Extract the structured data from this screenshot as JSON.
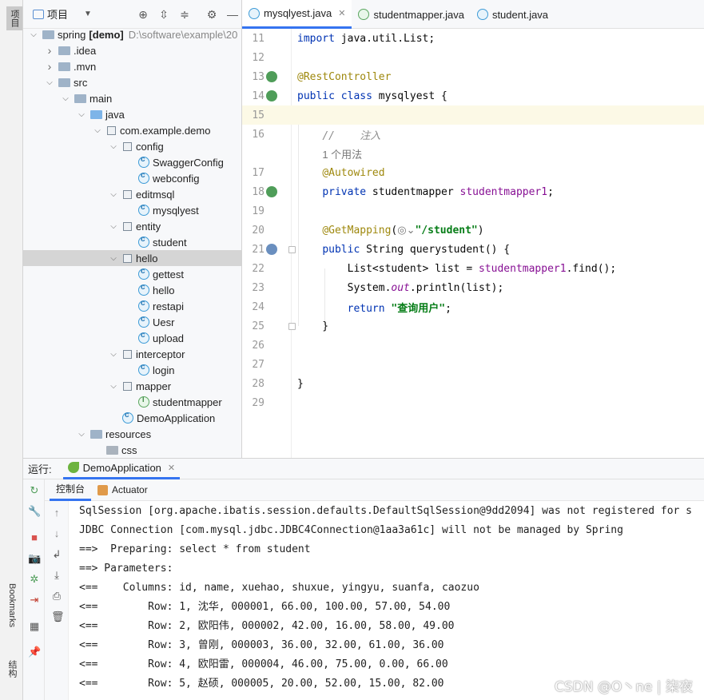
{
  "left_strip": {
    "project_tab": "项目",
    "bookmarks_tab": "Bookmarks",
    "structure_tab": "结构"
  },
  "project": {
    "header_title": "项目",
    "tree": [
      {
        "label": "spring",
        "bold_suffix": "[demo]",
        "path": "D:\\software\\example\\20",
        "depth": 0,
        "kind": "folder",
        "open": true
      },
      {
        "label": ".idea",
        "depth": 1,
        "kind": "folder",
        "open": false
      },
      {
        "label": ".mvn",
        "depth": 1,
        "kind": "folder",
        "open": false
      },
      {
        "label": "src",
        "depth": 1,
        "kind": "folder",
        "open": true
      },
      {
        "label": "main",
        "depth": 2,
        "kind": "folder",
        "open": true
      },
      {
        "label": "java",
        "depth": 3,
        "kind": "folder-blue",
        "open": true
      },
      {
        "label": "com.example.demo",
        "depth": 4,
        "kind": "pkg",
        "open": true
      },
      {
        "label": "config",
        "depth": 5,
        "kind": "pkg",
        "open": true
      },
      {
        "label": "SwaggerConfig",
        "depth": 6,
        "kind": "class"
      },
      {
        "label": "webconfig",
        "depth": 6,
        "kind": "class"
      },
      {
        "label": "editmsql",
        "depth": 5,
        "kind": "pkg",
        "open": true
      },
      {
        "label": "mysqlyest",
        "depth": 6,
        "kind": "class"
      },
      {
        "label": "entity",
        "depth": 5,
        "kind": "pkg",
        "open": true
      },
      {
        "label": "student",
        "depth": 6,
        "kind": "class"
      },
      {
        "label": "hello",
        "depth": 5,
        "kind": "pkg",
        "open": true,
        "selected": true
      },
      {
        "label": "gettest",
        "depth": 6,
        "kind": "class"
      },
      {
        "label": "hello",
        "depth": 6,
        "kind": "class"
      },
      {
        "label": "restapi",
        "depth": 6,
        "kind": "class"
      },
      {
        "label": "Uesr",
        "depth": 6,
        "kind": "class"
      },
      {
        "label": "upload",
        "depth": 6,
        "kind": "class"
      },
      {
        "label": "interceptor",
        "depth": 5,
        "kind": "pkg",
        "open": true
      },
      {
        "label": "login",
        "depth": 6,
        "kind": "class"
      },
      {
        "label": "mapper",
        "depth": 5,
        "kind": "pkg",
        "open": true
      },
      {
        "label": "studentmapper",
        "depth": 6,
        "kind": "iface"
      },
      {
        "label": "DemoApplication",
        "depth": 5,
        "kind": "class-spring"
      },
      {
        "label": "resources",
        "depth": 3,
        "kind": "folder",
        "open": true
      },
      {
        "label": "css",
        "depth": 4,
        "kind": "folder-gray"
      }
    ]
  },
  "editor": {
    "tabs": [
      {
        "label": "mysqlyest.java",
        "icon": "class-icon",
        "active": true
      },
      {
        "label": "studentmapper.java",
        "icon": "interface-icon",
        "active": false
      },
      {
        "label": "student.java",
        "icon": "class-icon",
        "active": false
      }
    ],
    "lines": [
      {
        "no": "11",
        "html": "<span class=\"kw\">import</span> java.util.List;"
      },
      {
        "no": "12",
        "html": ""
      },
      {
        "no": "13",
        "html": "<span class=\"ann\">@RestController</span>",
        "gutter": "bean"
      },
      {
        "no": "14",
        "html": "<span class=\"kw\">public class</span> mysqlyest {",
        "gutter": "bean"
      },
      {
        "no": "15",
        "html": "",
        "current": true
      },
      {
        "no": "16",
        "html": "    <span class=\"comment\">//    注入</span>"
      },
      {
        "no": "",
        "html": "    <span class=\"hint\">1 个用法</span>"
      },
      {
        "no": "17",
        "html": "    <span class=\"ann\">@Autowired</span>"
      },
      {
        "no": "18",
        "html": "    <span class=\"kw\">private</span> studentmapper <span class=\"field\">studentmapper1</span>;",
        "gutter": "bean"
      },
      {
        "no": "19",
        "html": ""
      },
      {
        "no": "20",
        "html": "    <span class=\"ann\">@GetMapping</span>(<span class=\"hint\">◎⌄</span><span class=\"str\">\"/student\"</span>)"
      },
      {
        "no": "21",
        "html": "    <span class=\"kw\">public</span> String querystudent() {",
        "gutter": "web",
        "fold": true
      },
      {
        "no": "22",
        "html": "        List&lt;student&gt; list = <span class=\"field\">studentmapper1</span>.find();"
      },
      {
        "no": "23",
        "html": "        System.<span class=\"static\">out</span>.println(list);"
      },
      {
        "no": "24",
        "html": "        <span class=\"kw\">return</span> <span class=\"str\">\"查询用户\"</span>;"
      },
      {
        "no": "25",
        "html": "    }",
        "fold": true
      },
      {
        "no": "26",
        "html": ""
      },
      {
        "no": "27",
        "html": ""
      },
      {
        "no": "28",
        "html": "}"
      },
      {
        "no": "29",
        "html": ""
      }
    ]
  },
  "run": {
    "label": "运行:",
    "tab": "DemoApplication",
    "subtabs": [
      "控制台",
      "Actuator"
    ],
    "console_lines": [
      "SqlSession [org.apache.ibatis.session.defaults.DefaultSqlSession@9dd2094] was not registered for s",
      "JDBC Connection [com.mysql.jdbc.JDBC4Connection@1aa3a61c] will not be managed by Spring",
      "==>  Preparing: select * from student",
      "==> Parameters: ",
      "<==    Columns: id, name, xuehao, shuxue, yingyu, suanfa, caozuo",
      "<==        Row: 1, 沈华, 000001, 66.00, 100.00, 57.00, 54.00",
      "<==        Row: 2, 欧阳伟, 000002, 42.00, 16.00, 58.00, 49.00",
      "<==        Row: 3, 曾刚, 000003, 36.00, 32.00, 61.00, 36.00",
      "<==        Row: 4, 欧阳雷, 000004, 46.00, 75.00, 0.00, 66.00",
      "<==        Row: 5, 赵硕, 000005, 20.00, 52.00, 15.00, 82.00"
    ]
  },
  "watermark": "CSDN @O丶ne | 柒夜"
}
